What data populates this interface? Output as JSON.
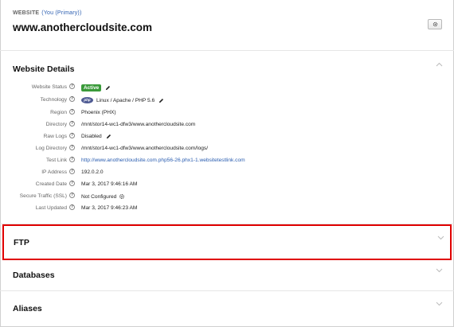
{
  "header": {
    "website_label": "WEBSITE",
    "owner_label": "(You (Primary))",
    "domain": "www.anothercloudsite.com",
    "settings_icon": "gear-icon"
  },
  "sections": {
    "details_title": "Website Details",
    "ftp_title": "FTP",
    "databases_title": "Databases",
    "aliases_title": "Aliases"
  },
  "details": {
    "status": {
      "label": "Website Status",
      "value": "Active"
    },
    "technology": {
      "label": "Technology",
      "logo_text": "php",
      "value": "Linux / Apache / PHP 5.6"
    },
    "region": {
      "label": "Region",
      "value": "Phoenix (PHX)"
    },
    "directory": {
      "label": "Directory",
      "value": "/mnt/stor14-wc1-dfw3/www.anothercloudsite.com"
    },
    "raw_logs": {
      "label": "Raw Logs",
      "value": "Disabled"
    },
    "log_directory": {
      "label": "Log Directory",
      "value": "/mnt/stor14-wc1-dfw3/www.anothercloudsite.com/logs/"
    },
    "test_link": {
      "label": "Test Link",
      "value": "http://www.anothercloudsite.com.php56-26.phx1-1.websitetestlink.com"
    },
    "ip_address": {
      "label": "IP Address",
      "value": "192.0.2.0"
    },
    "created_date": {
      "label": "Created Date",
      "value": "Mar 3, 2017 9:46:16 AM"
    },
    "secure_traffic": {
      "label": "Secure Traffic (SSL)",
      "value": "Not Configured"
    },
    "last_updated": {
      "label": "Last Updated",
      "value": "Mar 3, 2017 9:46:23 AM"
    }
  },
  "help_glyph": "?",
  "colors": {
    "active_badge": "#3a9a3a",
    "link": "#2a5db0",
    "highlight_border": "#e00000"
  }
}
